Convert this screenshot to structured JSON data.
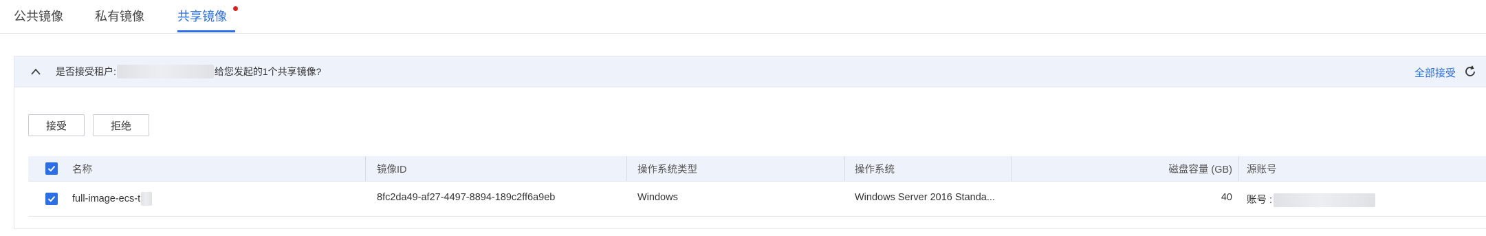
{
  "tabs": {
    "public": "公共镜像",
    "private": "私有镜像",
    "shared": "共享镜像"
  },
  "panel": {
    "prompt_prefix": "是否接受租户:",
    "prompt_suffix": "给您发起的1个共享镜像?",
    "accept_all": "全部接受"
  },
  "actions": {
    "accept": "接受",
    "reject": "拒绝"
  },
  "table": {
    "columns": {
      "name": "名称",
      "image_id": "镜像ID",
      "os_type": "操作系统类型",
      "os": "操作系统",
      "disk": "磁盘容量 (GB)",
      "source": "源账号"
    },
    "rows": [
      {
        "checked": true,
        "name": "full-image-ecs-t",
        "image_id": "8fc2da49-af27-4497-8894-189c2ff6a9eb",
        "os_type": "Windows",
        "os": "Windows Server 2016 Standa...",
        "disk": "40",
        "source": "账号 :"
      }
    ]
  },
  "icons": {
    "collapse": "chevron-up-icon",
    "refresh": "refresh-icon",
    "checkbox": "checkbox-checked-icon"
  },
  "colors": {
    "accent": "#2a6ee8",
    "notification_dot": "#e0201c",
    "header_bg": "#eef2fb"
  }
}
